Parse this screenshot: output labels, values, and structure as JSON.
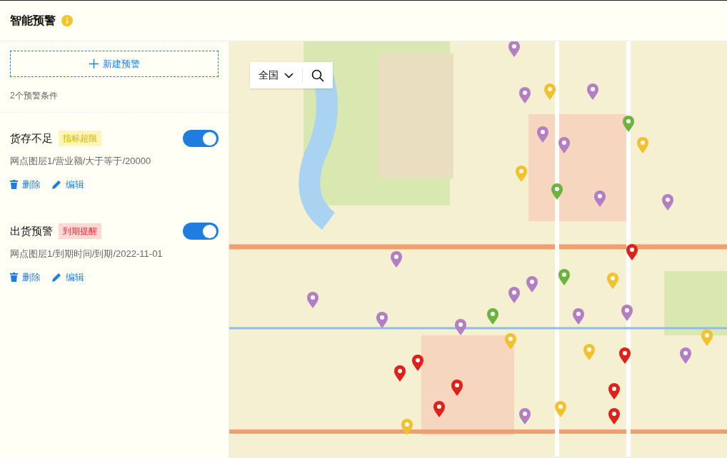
{
  "header": {
    "title": "智能预警"
  },
  "new_button": {
    "label": "新建预警"
  },
  "count_text": "2个预警条件",
  "alerts": [
    {
      "name": "货存不足",
      "tag": "指标超限",
      "kind": "warning",
      "on": true,
      "condition": "网点图层1/营业额/大于等于/20000",
      "delete_label": "删除",
      "edit_label": "编辑"
    },
    {
      "name": "出货预警",
      "tag": "到期提醒",
      "kind": "danger",
      "on": true,
      "condition": "网点图层1/到期时间/到期/2022-11-01",
      "delete_label": "删除",
      "edit_label": "编辑"
    }
  ],
  "map": {
    "region": "全国"
  }
}
